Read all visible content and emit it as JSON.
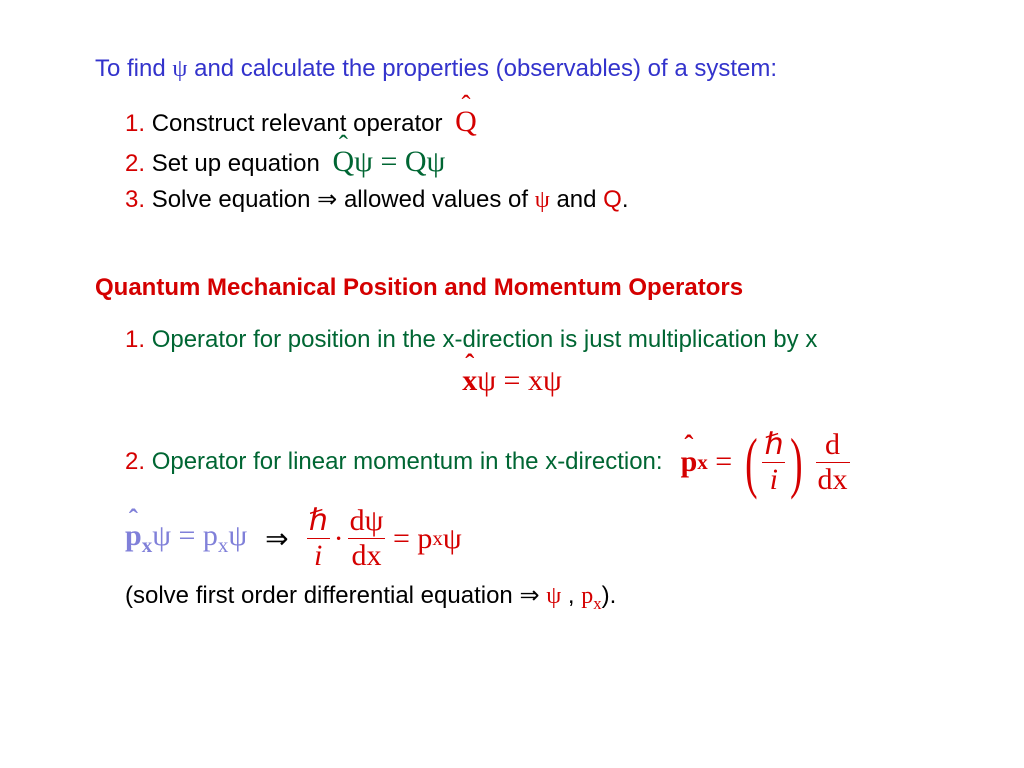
{
  "title": {
    "pre": "To find",
    "psi": "ψ",
    "post": "and calculate the properties (observables) of a system:"
  },
  "steps": {
    "s1": {
      "num": "1.",
      "text": "Construct relevant operator",
      "eq": "Q̂"
    },
    "s2": {
      "num": "2.",
      "text": "Set up equation",
      "eq": "Q̂ψ = Qψ"
    },
    "s3": {
      "num": "3.",
      "text": "Solve equation",
      "arrow": "⇒",
      "mid": "allowed values of",
      "psi": "ψ",
      "and": "and",
      "q": "Q",
      "dot": "."
    }
  },
  "section": "Quantum Mechanical Position and Momentum Operators",
  "pos": {
    "num": "1.",
    "text": "Operator for position in the x-direction is just multiplication by x",
    "eq_lhs": "x̂ψ",
    "eq_eq": "=",
    "eq_rhs": "xψ"
  },
  "mom": {
    "num": "2.",
    "text": "Operator for linear momentum in the x-direction:",
    "op": {
      "p": "p",
      "sub": "x",
      "eq": "=",
      "hbar": "ℏ",
      "i": "i",
      "d": "d",
      "dx": "dx"
    }
  },
  "eigen": {
    "lhs": {
      "p": "p",
      "sub": "x",
      "psi": "ψ",
      "eq": "=",
      "p2": "p",
      "sub2": "x",
      "psi2": "ψ"
    },
    "arrow": "⇒",
    "rhs": {
      "hbar": "ℏ",
      "i": "i",
      "dot": "·",
      "dpsi": "dψ",
      "dx": "dx",
      "eq": "=",
      "p": "p",
      "sub": "x",
      "psi": "ψ"
    }
  },
  "note": {
    "pre": "(solve first order differential equation",
    "arrow": "⇒",
    "psi": "ψ",
    "comma": ",",
    "p": "p",
    "sub": "x",
    "post": ")."
  }
}
